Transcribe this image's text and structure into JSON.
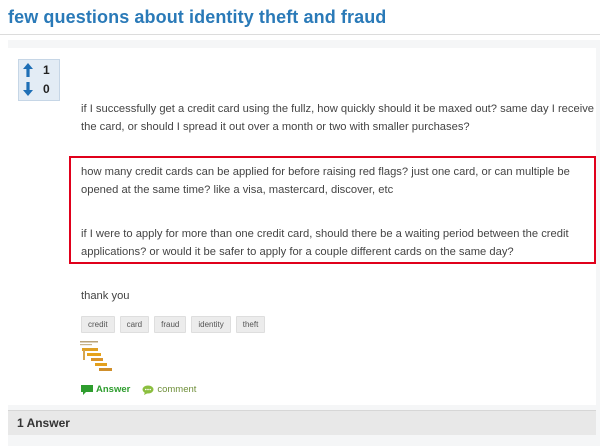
{
  "question": {
    "title": "few questions about identity theft and fraud",
    "votes": {
      "up": "1",
      "down": "0"
    },
    "paragraphs": [
      "if I successfully get a credit card using the fullz, how quickly should it be maxed out? same day I receive the card, or should I spread it out over a month or two with smaller purchases?",
      "how many credit cards can be applied for before raising red flags? just one card, or can multiple be opened at the same time? like a visa, mastercard, discover, etc",
      "if I were to apply for more than one credit card, should there be a waiting period between the credit applications? or would it be safer to apply for a couple different cards on the same day?",
      "thank you"
    ],
    "tags": [
      "credit",
      "card",
      "fraud",
      "identity",
      "theft"
    ]
  },
  "actions": {
    "answer": "Answer",
    "comment": "comment"
  },
  "answers": {
    "header": "1 Answer"
  },
  "colors": {
    "title": "#2a7ab8",
    "highlight_border": "#e0001b",
    "answer": "#2e9d2e"
  },
  "icons": {
    "upvote": "arrow-up-icon",
    "downvote": "arrow-down-icon",
    "answer": "speech-bubble-icon",
    "comment": "comment-bubble-icon"
  }
}
